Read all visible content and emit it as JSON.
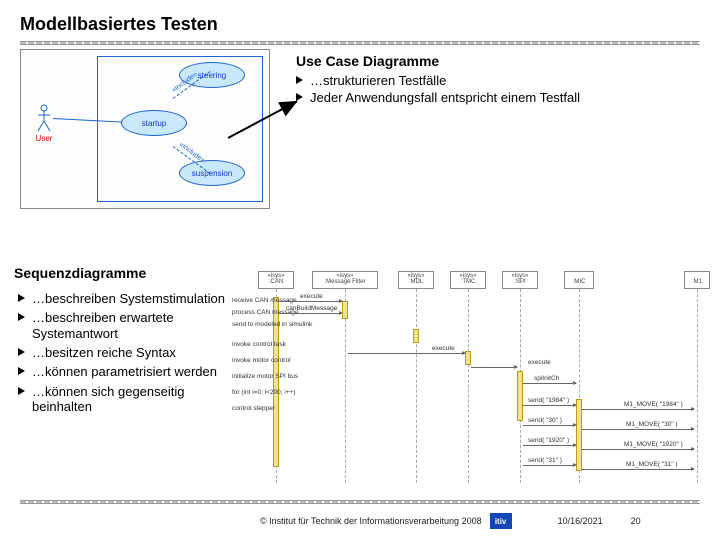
{
  "title": "Modellbasiertes Testen",
  "usecase": {
    "heading": "Use Case Diagramme",
    "bullets": [
      "…strukturieren Testfälle",
      "Jeder Anwendungsfall entspricht einem Testfall"
    ],
    "fig": {
      "actor": "User",
      "ellipses": {
        "steering": "steering",
        "startup": "startup",
        "suspension": "suspension"
      },
      "include_label": "«include»"
    }
  },
  "sequence": {
    "heading": "Sequenzdiagramme",
    "bullets": [
      "…beschreiben Systemstimulation",
      "…beschreiben erwartete Systemantwort",
      "…besitzen reiche Syntax",
      "…können parametrisiert werden",
      "…können sich gegenseitig beinhalten"
    ],
    "fig": {
      "lifelines": [
        {
          "stereo": "«isys»",
          "name": ":CAN"
        },
        {
          "stereo": "«isys»",
          "name": ":Message Filter"
        },
        {
          "stereo": "«isys»",
          "name": ":MDL"
        },
        {
          "stereo": "«isys»",
          "name": ":TMC"
        },
        {
          "stereo": "«isys»",
          "name": ":SPI"
        },
        {
          "stereo": "",
          "name": ":MIC"
        },
        {
          "stereo": "",
          "name": ":M1"
        }
      ],
      "messages_left": [
        "receive CAN message",
        "process CAN message",
        "send to modeled in simulink",
        "invoke control task",
        "invoke motor control",
        "initialize motor SPI bus",
        "for (int i=0; i<200; i++)",
        "control stepper"
      ],
      "messages_mid": [
        "execute",
        "canBuildMessage",
        "execute",
        "execute",
        "spiInitCh"
      ],
      "sends": [
        "send( \"1984\" )",
        "send( \"30\" )",
        "send( \"1920\" )",
        "send( \"31\" )"
      ],
      "moves": [
        "M1_MOVE( \"1984\" )",
        "M1_MOVE( \"30\" )",
        "M1_MOVE( \"1920\" )",
        "M1_MOVE( \"31\" )"
      ]
    }
  },
  "footer": {
    "copyright": "© Institut für Technik der Informationsverarbeitung  2008",
    "logo": "itiv",
    "date": "10/16/2021",
    "slide_no": "20"
  }
}
